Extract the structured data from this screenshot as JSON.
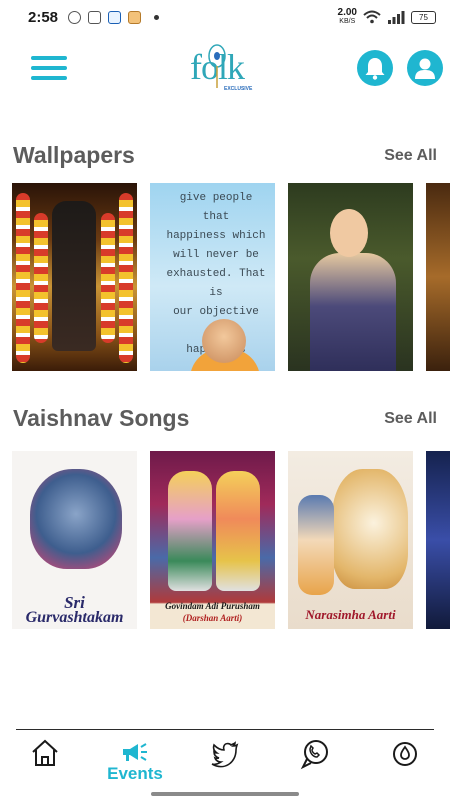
{
  "status_bar": {
    "time": "2:58",
    "speed_value": "2.00",
    "speed_unit": "KB/S",
    "battery": "75"
  },
  "header": {
    "logo_text": "folk",
    "logo_subtitle": "EXCLUSIVE",
    "menu_icon": "hamburger-icon",
    "notification_icon": "bell-icon",
    "profile_icon": "user-icon"
  },
  "sections": {
    "wallpapers": {
      "title": "Wallpapers",
      "see_all": "See All",
      "quote_lines": [
        "give people that",
        "happiness which",
        "will never be",
        "exhausted. That is",
        "our objective of",
        "happiness"
      ]
    },
    "songs": {
      "title": "Vaishnav Songs",
      "see_all": "See All",
      "items": [
        {
          "line1": "Sri",
          "line2": "Gurvashtakam"
        },
        {
          "line1": "Govindam Adi Purusham",
          "line2": "(Darshan Aarti)"
        },
        {
          "line1": "Narasimha Aarti",
          "line2": ""
        }
      ]
    }
  },
  "bottom_nav": {
    "items": [
      {
        "icon": "home-icon",
        "label": ""
      },
      {
        "icon": "megaphone-icon",
        "label": "Events"
      },
      {
        "icon": "twitter-icon",
        "label": ""
      },
      {
        "icon": "support-icon",
        "label": ""
      },
      {
        "icon": "drop-icon",
        "label": ""
      }
    ],
    "active_color": "#1fb6d0"
  },
  "colors": {
    "accent": "#1fb6d0",
    "section_title": "#5c5c5c"
  }
}
